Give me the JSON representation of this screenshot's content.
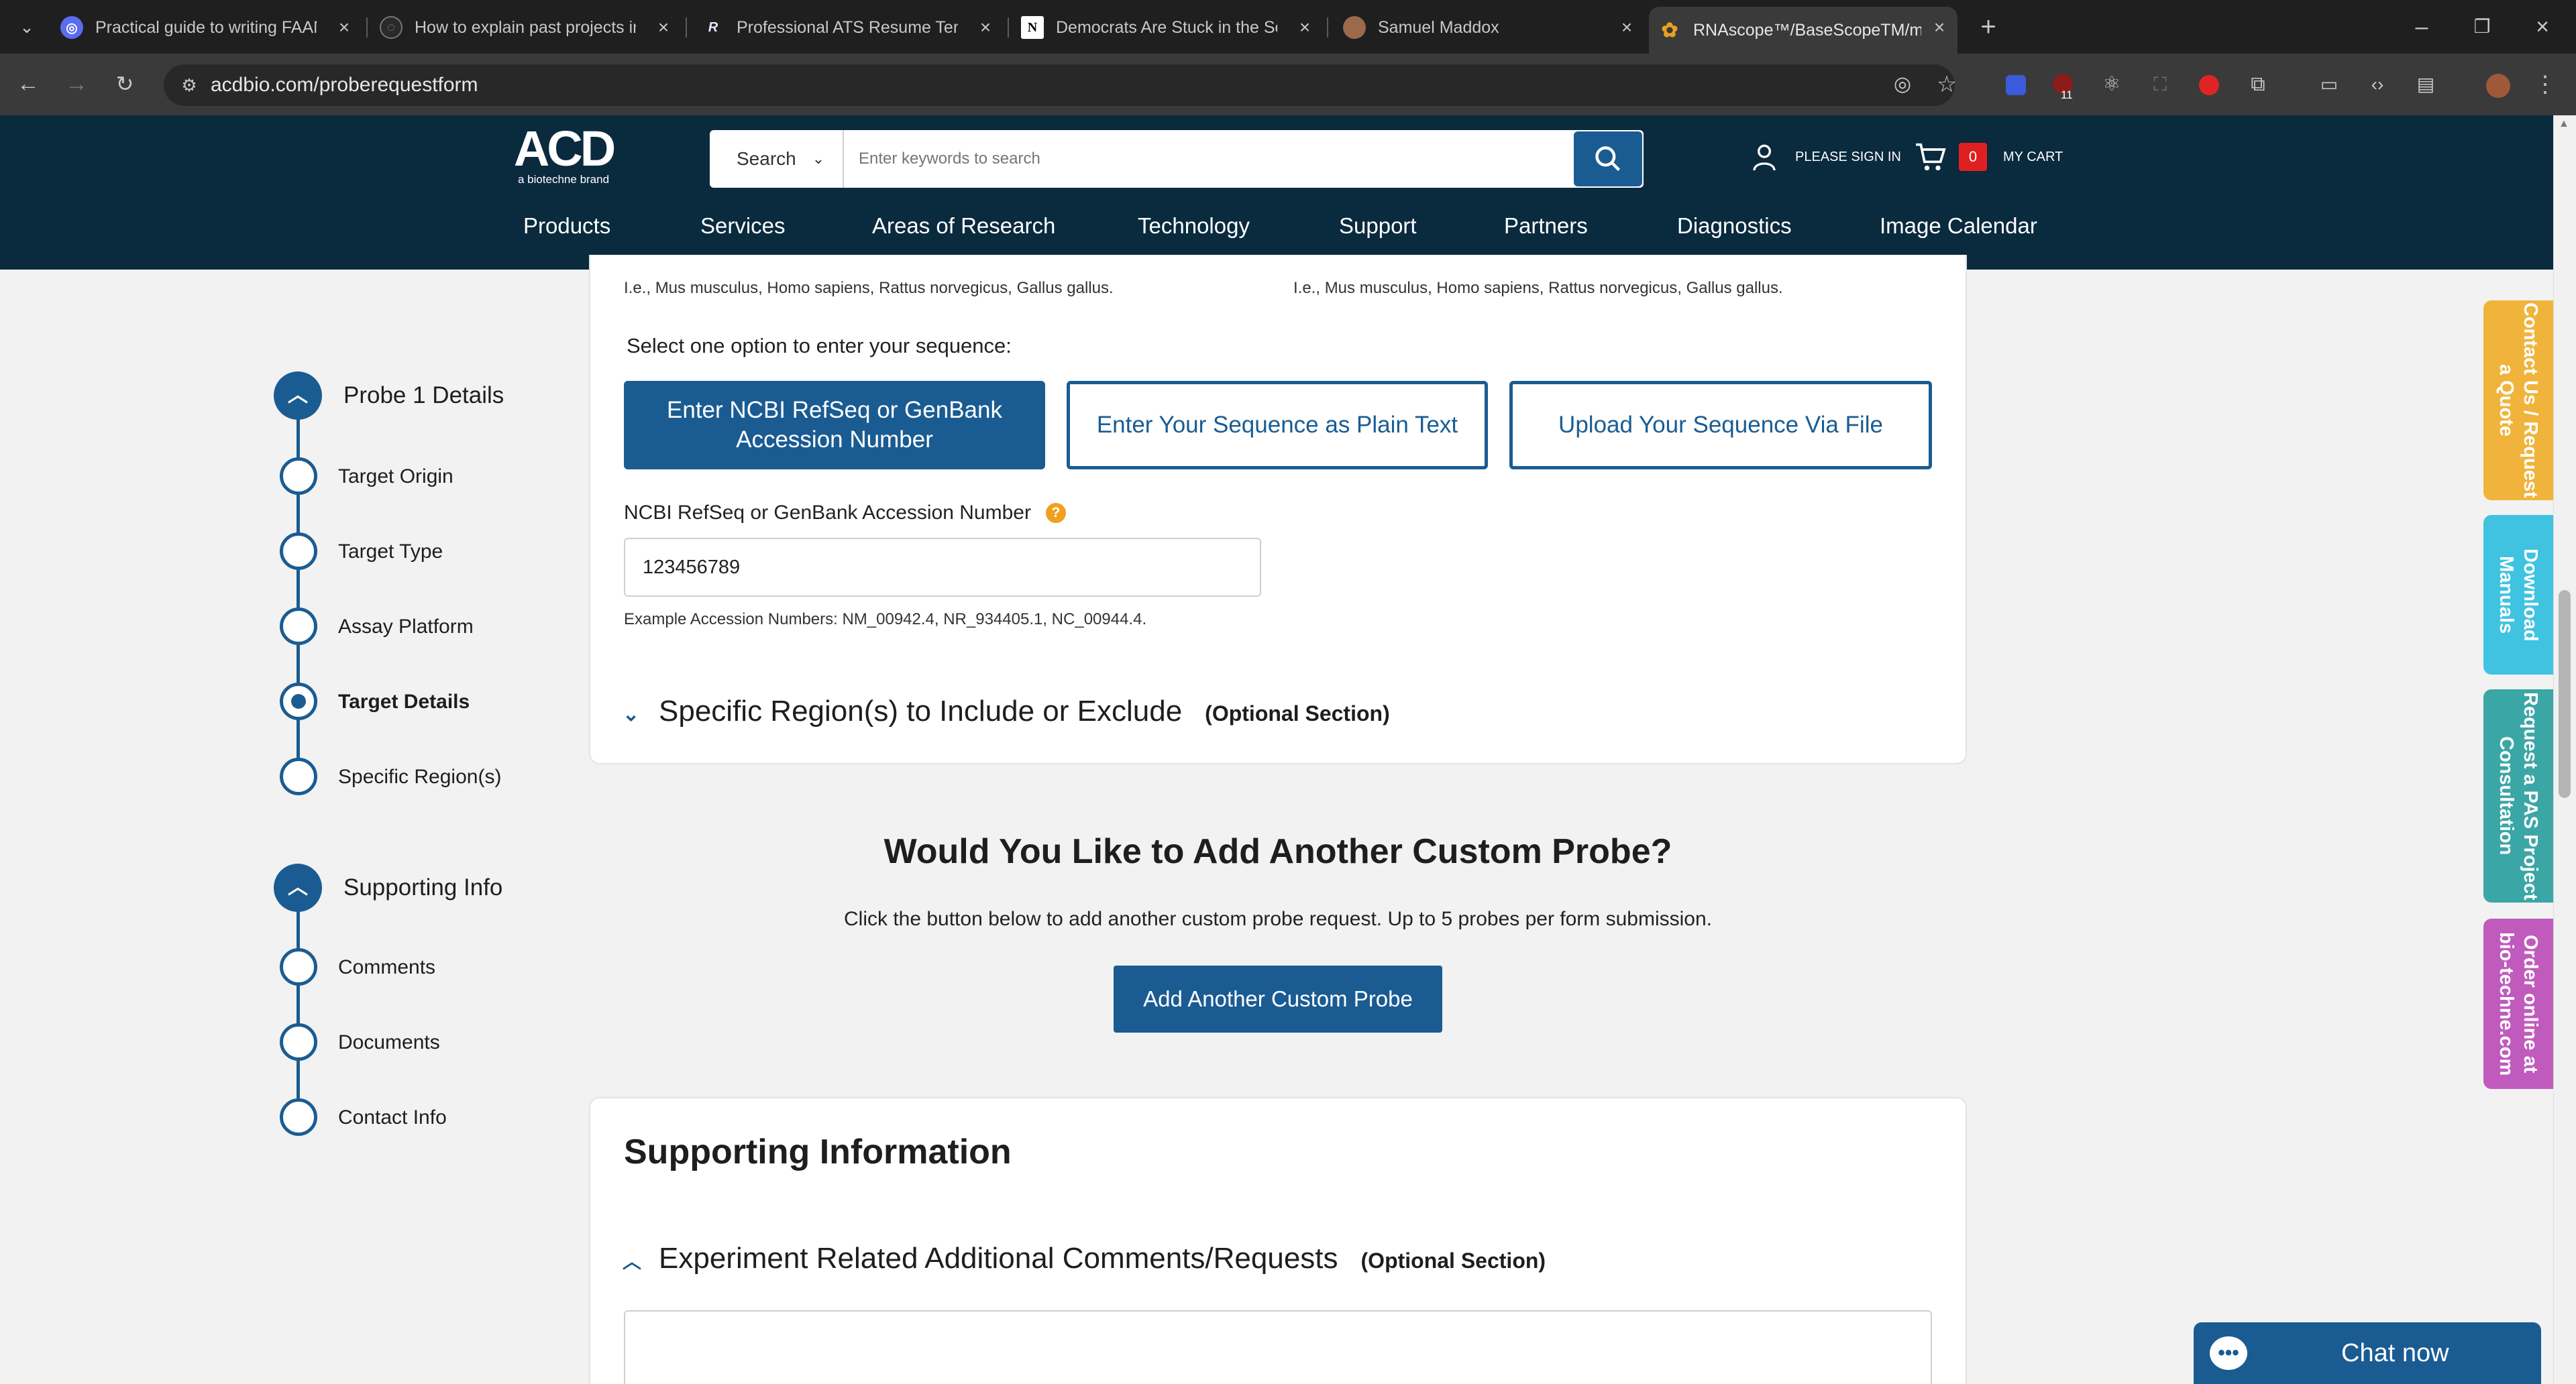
{
  "browser": {
    "tabs": [
      {
        "title": "Practical guide to writing FAANG",
        "favicon_color": "#5a6cf0",
        "favicon_glyph": "◎"
      },
      {
        "title": "How to explain past projects in",
        "favicon_color": "#555555",
        "favicon_glyph": "◌"
      },
      {
        "title": "Professional ATS Resume Templ",
        "favicon_color": "#1f1f1f",
        "favicon_glyph": "R"
      },
      {
        "title": "Democrats Are Stuck in the Sou",
        "favicon_color": "#ffffff",
        "favicon_glyph": "N"
      },
      {
        "title": "Samuel Maddox",
        "favicon_color": "#9b6a4a",
        "favicon_glyph": "●"
      },
      {
        "title": "RNAscope™/BaseScopeTM/miR",
        "favicon_color": "#e8a020",
        "favicon_glyph": "✿"
      }
    ],
    "url": "acdbio.com/proberequestform",
    "extension_badge": "11"
  },
  "site": {
    "logo_main": "ACD",
    "logo_sub": "a biotechne brand",
    "search_dropdown": "Search",
    "search_placeholder": "Enter keywords to search",
    "sign_in": "PLEASE SIGN IN",
    "cart_count": "0",
    "cart_label": "MY CART",
    "nav": [
      "Products",
      "Services",
      "Areas of Research",
      "Technology",
      "Support",
      "Partners",
      "Diagnostics",
      "Image Calendar"
    ]
  },
  "sidebar": {
    "probe_section": "Probe 1 Details",
    "probe_steps": [
      "Target Origin",
      "Target Type",
      "Assay Platform",
      "Target Details",
      "Specific Region(s)"
    ],
    "active_step": "Target Details",
    "supporting_section": "Supporting Info",
    "supporting_steps": [
      "Comments",
      "Documents",
      "Contact Info"
    ]
  },
  "form": {
    "species_hint_left": "I.e., Mus musculus, Homo sapiens, Rattus norvegicus, Gallus gallus.",
    "species_hint_right": "I.e., Mus musculus, Homo sapiens, Rattus norvegicus, Gallus gallus.",
    "sequence_prompt": "Select one option to enter your sequence:",
    "options": [
      "Enter NCBI RefSeq or GenBank Accession Number",
      "Enter Your Sequence as Plain Text",
      "Upload Your Sequence Via File"
    ],
    "accession_label": "NCBI RefSeq or GenBank Accession Number",
    "accession_help": "?",
    "accession_value": "123456789",
    "accession_example": "Example Accession Numbers: NM_00942.4, NR_934405.1, NC_00944.4.",
    "region_title": "Specific Region(s) to Include or Exclude",
    "region_optional": "(Optional Section)"
  },
  "add_probe": {
    "title": "Would You Like to Add Another Custom Probe?",
    "description": "Click the button below to add another custom probe request. Up to 5 probes per form submission.",
    "button": "Add Another Custom Probe"
  },
  "supporting": {
    "title": "Supporting Information",
    "comments_title": "Experiment Related Additional Comments/Requests",
    "comments_optional": "(Optional Section)"
  },
  "side_tabs": [
    {
      "label": "Contact Us / Request a Quote",
      "color": "#f0b43c"
    },
    {
      "label": "Download Manuals",
      "color": "#3fc3e0"
    },
    {
      "label": "Request a PAS Project Consultation",
      "color": "#3ba6a6"
    },
    {
      "label": "Order online at bio-techne.com",
      "color": "#c05bbd"
    }
  ],
  "chat": {
    "label": "Chat now"
  },
  "colors": {
    "brand_navy": "#0a2a3e",
    "brand_blue": "#1a5c92",
    "cart_badge": "#e02020"
  }
}
